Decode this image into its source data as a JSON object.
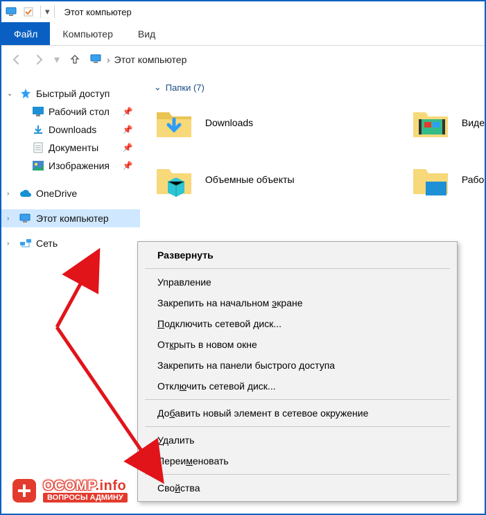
{
  "window": {
    "title": "Этот компьютер"
  },
  "ribbon": {
    "file": "Файл",
    "tab_computer": "Компьютер",
    "tab_view": "Вид"
  },
  "address": {
    "location": "Этот компьютер"
  },
  "tree": {
    "quick_access": "Быстрый доступ",
    "desktop": "Рабочий стол",
    "downloads": "Downloads",
    "documents": "Документы",
    "pictures": "Изображения",
    "onedrive": "OneDrive",
    "this_pc": "Этот компьютер",
    "network": "Сеть"
  },
  "content": {
    "group_header": "Папки (7)",
    "folders": {
      "downloads": "Downloads",
      "videos": "Виде",
      "objects3d": "Объемные объекты",
      "desktop": "Рабо"
    }
  },
  "context_menu": {
    "expand": "Развернуть",
    "manage": "Управление",
    "pin_start_pre": "Закрепить на начальном ",
    "pin_start_u": "э",
    "pin_start_post": "кране",
    "map_drive_pre_u": "П",
    "map_drive_post": "одключить сетевой диск...",
    "new_window_pre": "От",
    "new_window_u": "к",
    "new_window_post": "рыть в новом окне",
    "pin_qa": "Закрепить на панели быстрого доступа",
    "disconnect_pre": "Откл",
    "disconnect_u": "ю",
    "disconnect_post": "чить сетевой диск...",
    "add_net_pre": "До",
    "add_net_u": "б",
    "add_net_post": "авить новый элемент в сетевое окружение",
    "delete_u": "У",
    "delete_post": "далить",
    "rename_pre": "Переи",
    "rename_u": "м",
    "rename_post": "еновать",
    "props_pre": "Сво",
    "props_u": "й",
    "props_post": "ства"
  },
  "watermark": {
    "brand_a": "OCOMP",
    "brand_b": ".info",
    "sub": "ВОПРОСЫ АДМИНУ"
  }
}
